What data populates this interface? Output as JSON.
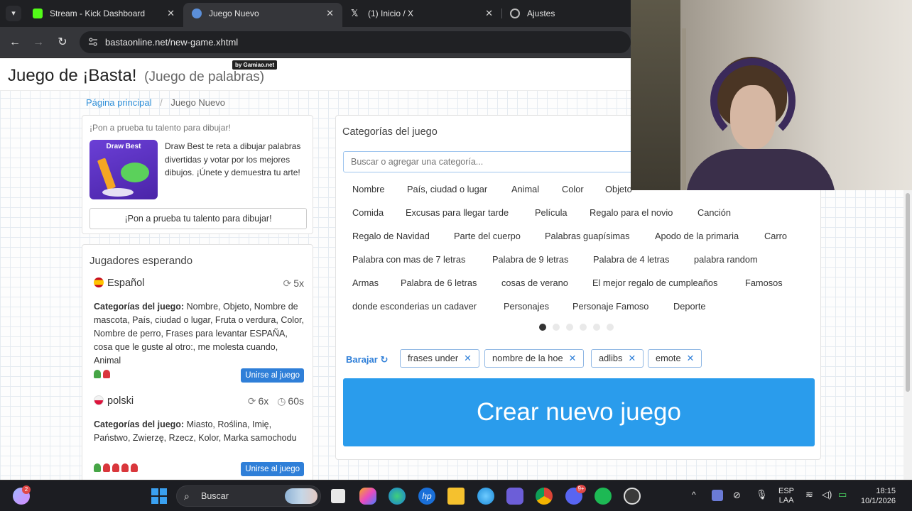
{
  "browser": {
    "tabs": [
      {
        "title": "Stream - Kick Dashboard",
        "close": "✕"
      },
      {
        "title": "Juego Nuevo",
        "close": "✕"
      },
      {
        "title": "(1) Inicio / X",
        "close": "✕"
      },
      {
        "title": "Ajustes"
      }
    ],
    "url": "bastaonline.net/new-game.xhtml"
  },
  "header": {
    "title": "Juego de ¡Basta!",
    "subtitle": "(Juego de palabras)",
    "badge": "by Gamiao.net"
  },
  "breadcrumb": {
    "home": "Página principal",
    "current": "Juego Nuevo"
  },
  "promo": {
    "title": "¡Pon a prueba tu talento para dibujar!",
    "image_text": "Draw Best",
    "description": "Draw Best te reta a dibujar palabras divertidas y votar por los mejores dibujos. ¡Únete y demuestra tu arte!",
    "button": "¡Pon a prueba tu talento para dibujar!"
  },
  "players": {
    "heading": "Jugadores esperando",
    "categories_label": "Categorías del juego:",
    "join_label": "Unirse al juego",
    "items": [
      {
        "language": "Español",
        "rounds": "5x",
        "categories": "Nombre, Objeto, Nombre de mascota, País, ciudad o lugar, Fruta o verdura, Color, Nombre de perro, Frases para levantar ESPAÑA, cosa que le guste al otro:, me molesta cuando, Animal",
        "pawns": [
          "g",
          "r"
        ]
      },
      {
        "language": "polski",
        "rounds": "6x",
        "time": "60s",
        "categories": "Miasto, Roślina, Imię, Państwo, Zwierzę, Rzecz, Kolor, Marka samochodu",
        "pawns": [
          "g",
          "r",
          "r",
          "r",
          "r"
        ]
      }
    ]
  },
  "categories": {
    "title": "Categorías del juego",
    "search_placeholder": "Buscar o agregar una categoría...",
    "rows": [
      [
        "Nombre",
        "País, ciudad o lugar",
        "Animal",
        "Color",
        "Objeto"
      ],
      [
        "Comida",
        "Excusas para llegar tarde",
        "Película",
        "Regalo para el novio",
        "Canción"
      ],
      [
        "Regalo de Navidad",
        "Parte del cuerpo",
        "Palabras guapísimas",
        "Apodo de la primaria",
        "Carro"
      ],
      [
        "Palabra con mas de 7 letras",
        "Palabra de 9 letras",
        "Palabra de 4 letras",
        "palabra random"
      ],
      [
        "Armas",
        "Palabra de 6 letras",
        "cosas de verano",
        "El mejor regalo de cumpleaños",
        "Famosos"
      ],
      [
        "donde esconderias un cadaver",
        "Personajes",
        "Personaje Famoso",
        "Deporte"
      ]
    ],
    "shuffle": "Barajar",
    "selected": [
      "frases under",
      "nombre de la hoe",
      "adlibs",
      "emote"
    ],
    "create_button": "Crear nuevo juego"
  },
  "taskbar": {
    "search": "Buscar",
    "notification_count": "2",
    "discord_badge": "9+",
    "lang_line1": "ESP",
    "lang_line2": "LAA",
    "time": "18:15",
    "date": "10/1/2026"
  }
}
